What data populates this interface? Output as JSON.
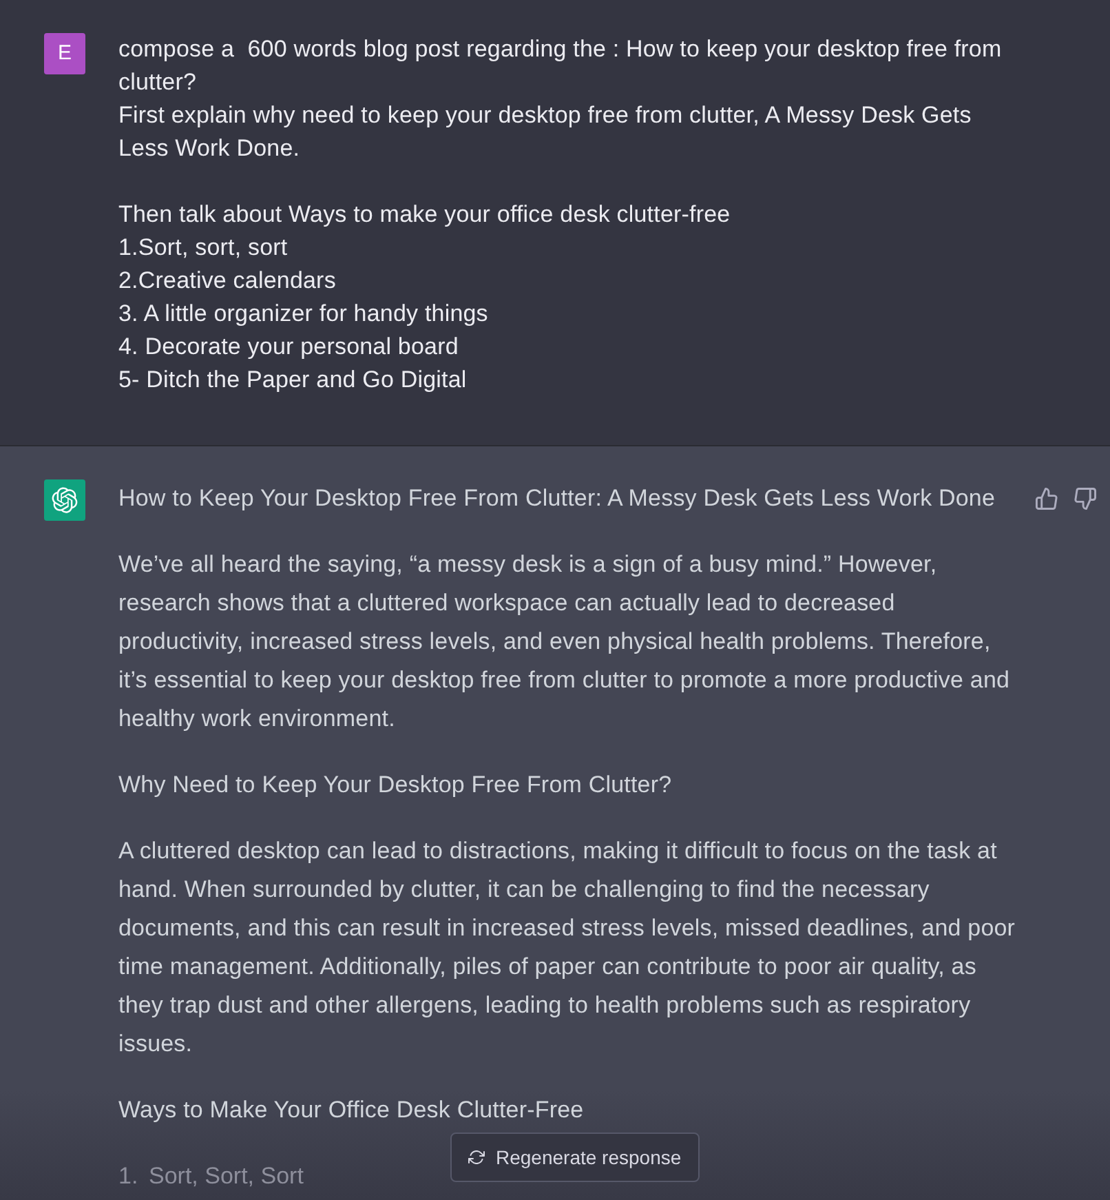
{
  "conversation": [
    {
      "kind": "user",
      "avatar": "E",
      "text": "compose a  600 words blog post regarding the : How to keep your desktop free from clutter?\nFirst explain why need to keep your desktop free from clutter, A Messy Desk Gets Less Work Done.\n\nThen talk about Ways to make your office desk clutter-free\n1.Sort, sort, sort\n2.Creative calendars\n3. A little organizer for handy things\n4. Decorate your personal board\n5- Ditch the Paper and Go Digital"
    },
    {
      "kind": "assistant",
      "blocks": [
        {
          "kind": "paragraph",
          "text": "How to Keep Your Desktop Free From Clutter: A Messy Desk Gets Less Work Done"
        },
        {
          "kind": "paragraph",
          "text": "We’ve all heard the saying, “a messy desk is a sign of a busy mind.” However, research shows that a cluttered workspace can actually lead to decreased productivity, increased stress levels, and even physical health problems. Therefore, it’s essential to keep your desktop free from clutter to promote a more productive and healthy work environment."
        },
        {
          "kind": "paragraph",
          "text": "Why Need to Keep Your Desktop Free From Clutter?"
        },
        {
          "kind": "paragraph",
          "text": "A cluttered desktop can lead to distractions, making it difficult to focus on the task at hand. When surrounded by clutter, it can be challenging to find the necessary documents, and this can result in increased stress levels, missed deadlines, and poor time management. Additionally, piles of paper can contribute to poor air quality, as they trap dust and other allergens, leading to health problems such as respiratory issues."
        },
        {
          "kind": "paragraph",
          "text": "Ways to Make Your Office Desk Clutter-Free"
        },
        {
          "kind": "list",
          "items": [
            {
              "number": "1.",
              "text": "Sort, Sort, Sort"
            }
          ]
        }
      ]
    }
  ],
  "regenerate_button": {
    "label": "Regenerate response"
  }
}
